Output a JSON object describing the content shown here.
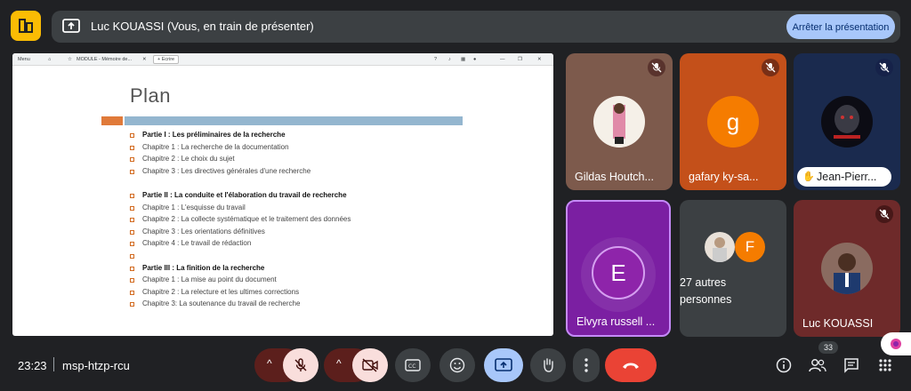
{
  "top_bar": {
    "presenter_text": "Luc KOUASSI (Vous, en train de présenter)",
    "stop_button": "Arrêter la présentation"
  },
  "shared_screen": {
    "browser": {
      "menu_label": "Menu",
      "tab_title": "MODULE - Mémoire de...",
      "new_tab_label": "+ Ecrire"
    },
    "slide": {
      "title": "Plan",
      "lines": [
        {
          "text": "Partie  I : Les préliminaires de la recherche",
          "kind": "part"
        },
        {
          "text": "Chapitre 1 : La recherche de la documentation",
          "kind": "item"
        },
        {
          "text": "Chapitre 2 : Le choix du sujet",
          "kind": "item"
        },
        {
          "text": "Chapitre 3 : Les directives générales d'une recherche",
          "kind": "item"
        },
        {
          "text": "",
          "kind": "gap"
        },
        {
          "text": "Partie II : La conduite et l'élaboration du travail de recherche",
          "kind": "part"
        },
        {
          "text": "Chapitre 1 : L'esquisse du travail",
          "kind": "item"
        },
        {
          "text": "Chapitre 2 : La collecte systématique et le traitement des données",
          "kind": "item"
        },
        {
          "text": "Chapitre 3 : Les orientations définitives",
          "kind": "item"
        },
        {
          "text": "Chapitre 4 : Le travail de rédaction",
          "kind": "item"
        },
        {
          "text": "",
          "kind": "bullet"
        },
        {
          "text": "Partie III : La finition de la recherche",
          "kind": "part"
        },
        {
          "text": "Chapitre 1 : La mise au point du document",
          "kind": "item"
        },
        {
          "text": "Chapitre 2 : La relecture et les ultimes corrections",
          "kind": "item"
        },
        {
          "text": "Chapitre 3: La soutenance du travail de recherche",
          "kind": "item"
        }
      ]
    }
  },
  "participants": {
    "gildas": {
      "name": "Gildas Houtch..."
    },
    "gafary": {
      "name": "gafary ky-sa...",
      "initial": "g"
    },
    "jean": {
      "name": "Jean-Pierr..."
    },
    "elvyra": {
      "name": "Elvyra russell ...",
      "initial": "E"
    },
    "others": {
      "label": "27 autres personnes",
      "initial": "F"
    },
    "luc": {
      "name": "Luc KOUASSI"
    }
  },
  "bottom_bar": {
    "time": "23:23",
    "meeting_code": "msp-htzp-rcu",
    "participant_count": "33"
  },
  "colors": {
    "background": "#202124",
    "stop_button": "#a8c7fa",
    "end_call": "#ea4335",
    "present_active": "#a8c7fa",
    "elvyra_tile": "#7b1fa2",
    "gafary_avatar": "#f57c00"
  }
}
